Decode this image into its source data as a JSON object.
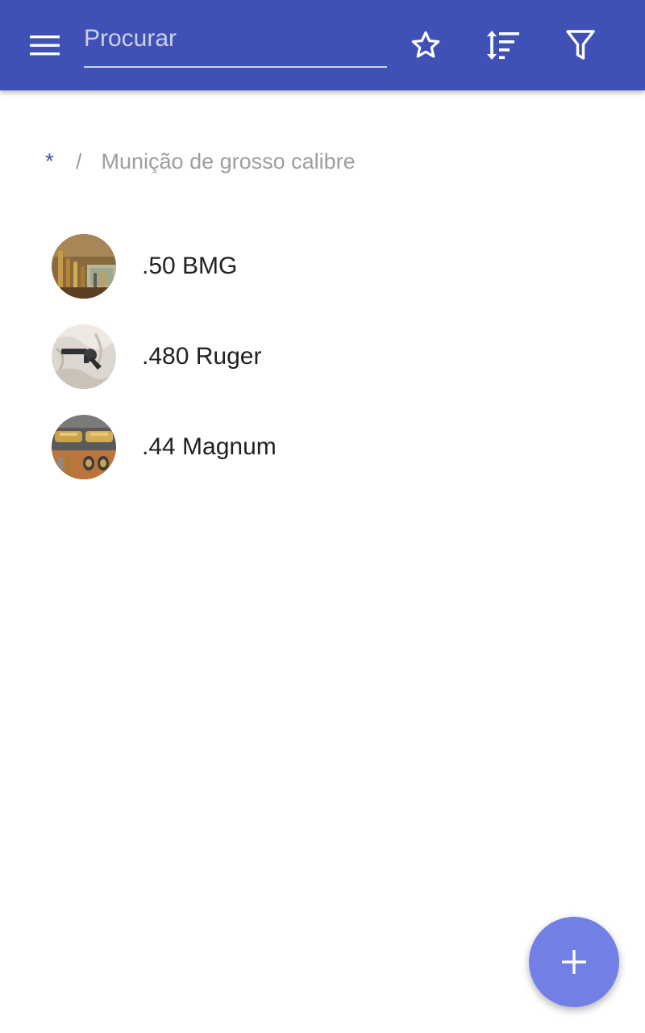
{
  "colors": {
    "app_bar": "#3f51b5",
    "fab": "#7280e6",
    "breadcrumb_root": "#3f51b5",
    "breadcrumb_text": "#9e9e9e",
    "item_text": "#212121"
  },
  "app_bar": {
    "menu_icon": "hamburger-menu-icon",
    "search": {
      "placeholder": "Procurar",
      "value": ""
    },
    "actions": [
      {
        "icon": "star-outline-icon"
      },
      {
        "icon": "sort-icon"
      },
      {
        "icon": "filter-icon"
      }
    ]
  },
  "breadcrumb": {
    "root": "*",
    "separator": "/",
    "current": "Munição de grosso calibre"
  },
  "items": [
    {
      "label": ".50 BMG",
      "thumbnail": "cartridges-with-banknote-photo"
    },
    {
      "label": ".480 Ruger",
      "thumbnail": "revolver-on-cloth-photo"
    },
    {
      "label": ".44 Magnum",
      "thumbnail": "cartridges-in-case-photo"
    }
  ],
  "fab": {
    "icon": "plus-icon"
  }
}
